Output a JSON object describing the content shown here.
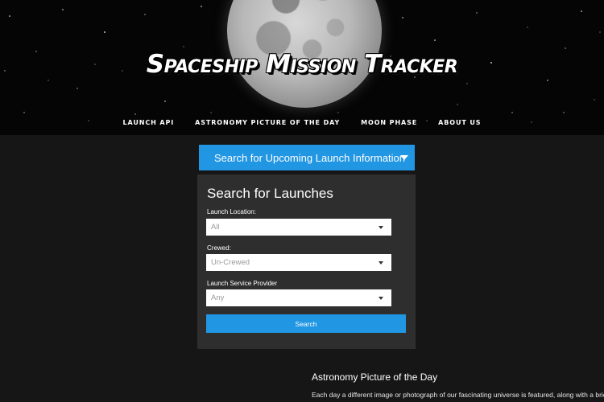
{
  "app": {
    "title": "Spaceship Mission Tracker"
  },
  "nav": {
    "items": [
      {
        "label": "LAUNCH API"
      },
      {
        "label": "ASTRONOMY PICTURE OF THE DAY"
      },
      {
        "label": "MOON PHASE"
      },
      {
        "label": "ABOUT US"
      }
    ]
  },
  "accordion": {
    "title": "Search for Upcoming Launch Information",
    "icon": "caret-down-icon"
  },
  "search": {
    "heading": "Search for Launches",
    "fields": [
      {
        "label": "Launch Location:",
        "value": "All"
      },
      {
        "label": "Crewed:",
        "value": "Un-Crewed"
      },
      {
        "label": "Launch Service Provider",
        "value": "Any"
      }
    ],
    "button_label": "Search"
  },
  "apod": {
    "heading": "Astronomy Picture of the Day",
    "description": "Each day a different image or photograph of our fascinating universe is featured, along with a brief explanation written by a professional astronomer."
  },
  "colors": {
    "accent": "#2196e3",
    "background": "#161616",
    "panel": "#2e2e2e"
  }
}
